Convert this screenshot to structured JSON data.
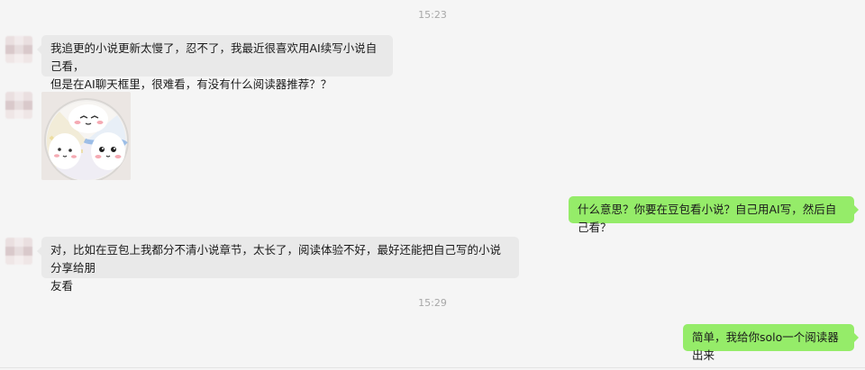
{
  "timestamps": [
    "15:23",
    "15:29"
  ],
  "messages": {
    "m1": "我追更的小说更新太慢了，忍不了，我最近很喜欢用AI续写小说自己看，\n但是在AI聊天框里，很难看，有没有什么阅读器推荐？？",
    "m3": "什么意思？你要在豆包看小说？自己用AI写，然后自己看？",
    "m4": "对，比如在豆包上我都分不清小说章节，太长了，阅读体验不好，最好还能把自己写的小说分享给朋\n友看",
    "m5": "简单，我给你solo一个阅读器出来"
  },
  "colors": {
    "background": "#f5f5f5",
    "incoming_bubble": "#e9e9e9",
    "outgoing_bubble": "#95ec69",
    "timestamp_text": "#a8a8a8"
  },
  "sticker": {
    "icon": "cartoon-faces-sticker-icon"
  }
}
